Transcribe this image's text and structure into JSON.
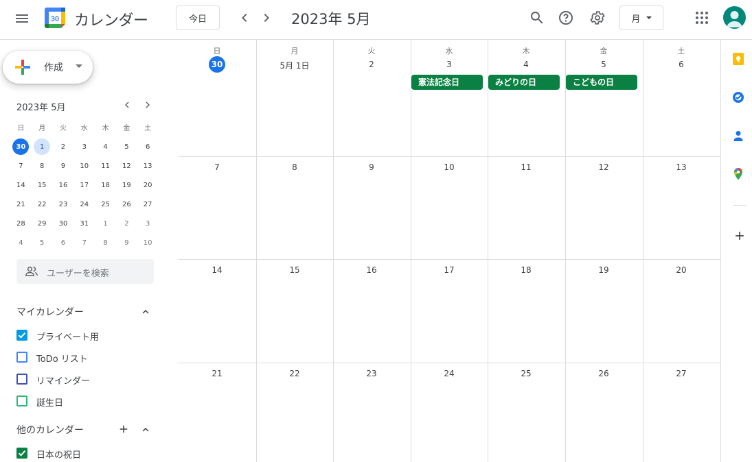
{
  "header": {
    "app_title": "カレンダー",
    "logo_day": "30",
    "today_label": "今日",
    "month_title": "2023年 5月",
    "view_label": "月",
    "icons": [
      "menu-icon",
      "chevron-left-icon",
      "chevron-right-icon",
      "search-icon",
      "help-icon",
      "settings-icon",
      "apps-icon",
      "avatar"
    ]
  },
  "sidebar": {
    "create_label": "作成",
    "mini_title": "2023年 5月",
    "mini_weekdays": [
      "日",
      "月",
      "火",
      "水",
      "木",
      "金",
      "土"
    ],
    "mini_weeks": [
      [
        "30",
        "1",
        "2",
        "3",
        "4",
        "5",
        "6"
      ],
      [
        "7",
        "8",
        "9",
        "10",
        "11",
        "12",
        "13"
      ],
      [
        "14",
        "15",
        "16",
        "17",
        "18",
        "19",
        "20"
      ],
      [
        "21",
        "22",
        "23",
        "24",
        "25",
        "26",
        "27"
      ],
      [
        "28",
        "29",
        "30",
        "31",
        "1",
        "2",
        "3"
      ],
      [
        "4",
        "5",
        "6",
        "7",
        "8",
        "9",
        "10"
      ]
    ],
    "search_people_placeholder": "ユーザーを検索",
    "my_calendars_title": "マイカレンダー",
    "my_calendars": [
      {
        "label": "プライベート用",
        "checked": true,
        "color": "#039be5"
      },
      {
        "label": "ToDo リスト",
        "checked": false,
        "color": "#4285f4"
      },
      {
        "label": "リマインダー",
        "checked": false,
        "color": "#3f51b5"
      },
      {
        "label": "誕生日",
        "checked": false,
        "color": "#33b679"
      }
    ],
    "other_calendars_title": "他のカレンダー",
    "other_calendars": [
      {
        "label": "日本の祝日",
        "checked": true,
        "color": "#0b8043"
      }
    ]
  },
  "grid": {
    "weekdays": [
      "日",
      "月",
      "火",
      "水",
      "木",
      "金",
      "土"
    ],
    "weeks": [
      [
        "30",
        "5月 1日",
        "2",
        "3",
        "4",
        "5",
        "6"
      ],
      [
        "7",
        "8",
        "9",
        "10",
        "11",
        "12",
        "13"
      ],
      [
        "14",
        "15",
        "16",
        "17",
        "18",
        "19",
        "20"
      ],
      [
        "21",
        "22",
        "23",
        "24",
        "25",
        "26",
        "27"
      ]
    ],
    "events": [
      {
        "title": "憲法記念日",
        "week": 0,
        "day": 3,
        "color": "#0b8043"
      },
      {
        "title": "みどりの日",
        "week": 0,
        "day": 4,
        "color": "#0b8043"
      },
      {
        "title": "こどもの日",
        "week": 0,
        "day": 5,
        "color": "#0b8043"
      }
    ]
  },
  "rightbar": {
    "icons": [
      "keep-icon",
      "tasks-icon",
      "contacts-icon",
      "maps-icon",
      "add-icon"
    ]
  },
  "colors": {
    "accent": "#1a73e8",
    "holiday": "#0b8043",
    "border": "#dadce0"
  }
}
